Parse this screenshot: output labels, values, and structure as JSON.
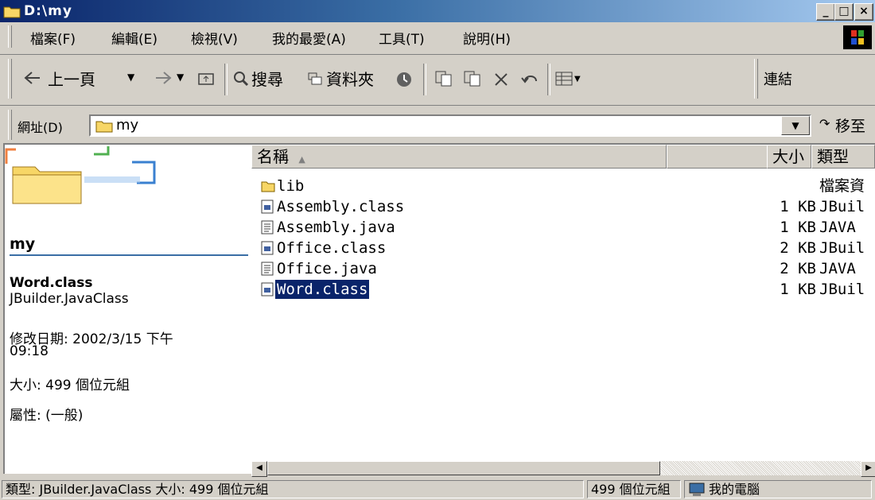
{
  "window": {
    "title": "D:\\my",
    "controls": {
      "minimize": "_",
      "maximize": "□",
      "close": "×"
    }
  },
  "menu": [
    "檔案(F)",
    "編輯(E)",
    "檢視(V)",
    "我的最愛(A)",
    "工具(T)",
    "說明(H)"
  ],
  "toolbar": {
    "back": "上一頁",
    "search": "搜尋",
    "folders": "資料夾",
    "links": "連結"
  },
  "address": {
    "label": "網址(D)",
    "value": "my",
    "go": "移至"
  },
  "left_pane": {
    "folder_name": "my",
    "file_name": "Word.class",
    "file_type": "JBuilder.JavaClass",
    "modified": "修改日期: 2002/3/15 下午",
    "modified_time": "09:18",
    "size": "大小: 499 個位元組",
    "attributes": "屬性: (一般)"
  },
  "columns": {
    "name": "名稱",
    "size": "大小",
    "type": "類型"
  },
  "files": [
    {
      "name": "lib",
      "size": "",
      "type": "檔案資",
      "icon": "folder-icon"
    },
    {
      "name": "Assembly.class",
      "size": "1 KB",
      "type": "JBuil",
      "icon": "class-file-icon"
    },
    {
      "name": "Assembly.java",
      "size": "1 KB",
      "type": "JAVA",
      "icon": "text-file-icon"
    },
    {
      "name": "Office.class",
      "size": "2 KB",
      "type": "JBuil",
      "icon": "class-file-icon"
    },
    {
      "name": "Office.java",
      "size": "2 KB",
      "type": "JAVA",
      "icon": "text-file-icon"
    },
    {
      "name": "Word.class",
      "size": "1 KB",
      "type": "JBuil",
      "icon": "class-file-icon",
      "selected": true
    }
  ],
  "status": {
    "left": "類型: JBuilder.JavaClass 大小: 499 個位元組",
    "middle": "499 個位元組",
    "right": "我的電腦"
  },
  "colors": {
    "title_start": "#0a246a",
    "title_end": "#a6caf0",
    "selection": "#0a246a",
    "face": "#d4d0c8",
    "folder": "#f7d666"
  }
}
